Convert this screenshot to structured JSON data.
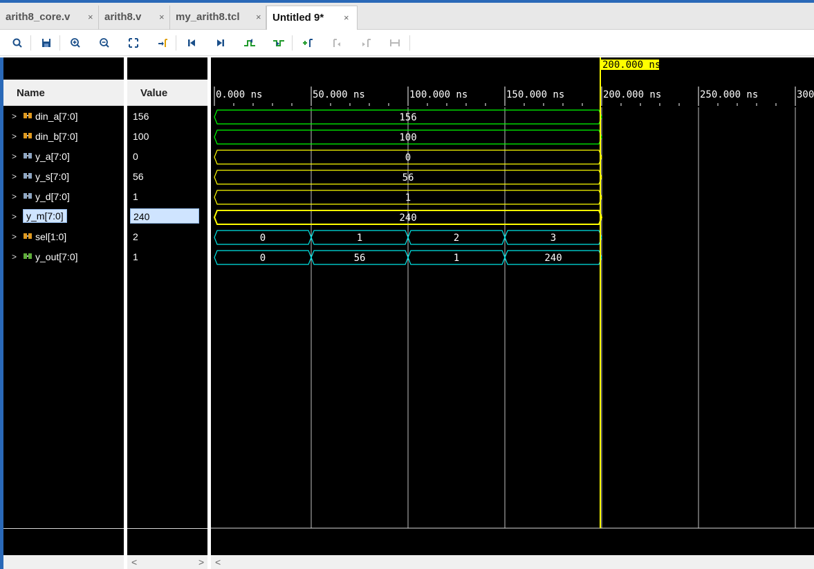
{
  "tabs": [
    {
      "label": "arith8_core.v",
      "close": "×"
    },
    {
      "label": "arith8.v",
      "close": "×"
    },
    {
      "label": "my_arith8.tcl",
      "close": "×"
    },
    {
      "label": "Untitled 9*",
      "close": "×"
    }
  ],
  "toolbar": {
    "icons": [
      "search-icon",
      "save-icon",
      "zoom-in-icon",
      "zoom-out-icon",
      "zoom-fit-icon",
      "go-to-cursor-icon",
      "go-to-time-zero-icon",
      "go-to-last-time-icon",
      "previous-transition-icon",
      "next-transition-icon",
      "add-marker-icon",
      "previous-marker-icon",
      "next-marker-icon",
      "swap-cursors-icon"
    ]
  },
  "columns": {
    "name": "Name",
    "value": "Value"
  },
  "cursor": {
    "label": "200.000 ns",
    "color": "#ffff00"
  },
  "timeline": {
    "ticks": [
      "0.000 ns",
      "50.000 ns",
      "100.000 ns",
      "150.000 ns",
      "200.000 ns",
      "250.000 ns",
      "300"
    ]
  },
  "signals": [
    {
      "name": "din_a[7:0]",
      "value": "156",
      "icon": "input-bus-icon",
      "color": "#00ff00",
      "segments": [
        "156"
      ]
    },
    {
      "name": "din_b[7:0]",
      "value": "100",
      "icon": "input-bus-icon",
      "color": "#00ff00",
      "segments": [
        "100"
      ]
    },
    {
      "name": "y_a[7:0]",
      "value": "0",
      "icon": "output-bus-icon",
      "color": "#ffff00",
      "segments": [
        "0"
      ]
    },
    {
      "name": "y_s[7:0]",
      "value": "56",
      "icon": "output-bus-icon",
      "color": "#ffff00",
      "segments": [
        "56"
      ]
    },
    {
      "name": "y_d[7:0]",
      "value": "1",
      "icon": "output-bus-icon",
      "color": "#ffff00",
      "segments": [
        "1"
      ]
    },
    {
      "name": "y_m[7:0]",
      "value": "240",
      "icon": "output-bus-icon",
      "color": "#ffff00",
      "segments": [
        "240"
      ],
      "selected": true
    },
    {
      "name": "sel[1:0]",
      "value": "2",
      "icon": "input-bus-icon",
      "color": "#00e5e5",
      "segments": [
        "0",
        "1",
        "2",
        "3"
      ]
    },
    {
      "name": "y_out[7:0]",
      "value": "1",
      "icon": "output-bus-icon-green",
      "color": "#00e5e5",
      "segments": [
        "0",
        "56",
        "1",
        "240"
      ]
    }
  ],
  "scroll": {
    "left": "<",
    "right": ">"
  }
}
